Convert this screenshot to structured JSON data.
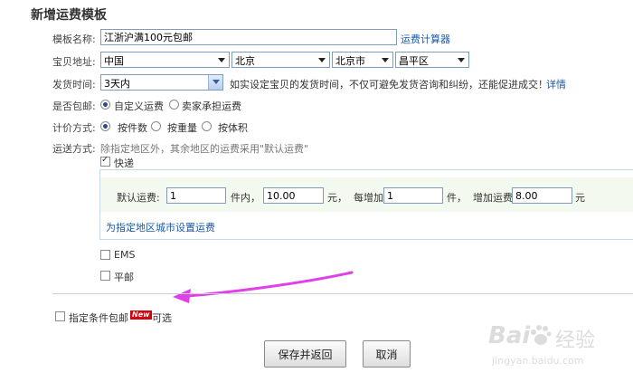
{
  "page_title": "新增运费模板",
  "template_name": {
    "label": "模板名称:",
    "value": "江浙沪满100元包邮",
    "calculator_link": "运费计算器"
  },
  "address": {
    "label": "宝贝地址:",
    "country": "中国",
    "province": "北京",
    "city": "北京市",
    "district": "昌平区"
  },
  "ship_time": {
    "label": "发货时间:",
    "value": "3天内",
    "hint": "如实设定宝贝的发货时间，不仅可避免发货咨询和纠纷，还能促进成交！",
    "detail_link": "详情"
  },
  "free_shipping": {
    "label": "是否包邮:",
    "option_custom": "自定义运费",
    "option_seller": "卖家承担运费",
    "selected": "自定义运费"
  },
  "pricing": {
    "label": "计价方式:",
    "option_piece": "按件数",
    "option_weight": "按重量",
    "option_volume": "按体积",
    "selected": "按件数"
  },
  "delivery": {
    "label": "运送方式:",
    "hint": "除指定地区外，其余地区的运费采用\"默认运费\"",
    "express": {
      "label": "快递",
      "checked": true,
      "default_fee_label": "默认运费:",
      "first_qty": "1",
      "within_label": "件内，",
      "first_fee": "10.00",
      "yuan_each_label": "元，  每增加",
      "add_qty": "1",
      "piece_add_label": "件，  增加运费",
      "add_fee": "8.00",
      "yuan_label": "元",
      "region_link": "为指定地区城市设置运费"
    },
    "ems": {
      "label": "EMS",
      "checked": false
    },
    "surface": {
      "label": "平邮",
      "checked": false
    }
  },
  "conditional_free": {
    "label": "指定条件包邮",
    "badge": "New",
    "optional": "可选",
    "checked": false
  },
  "buttons": {
    "save": "保存并返回",
    "cancel": "取消"
  },
  "watermark": {
    "brand": "Bai",
    "brand_tail": "经验",
    "url": "jingyan.baidu.com"
  },
  "colors": {
    "link": "#1b5aa6",
    "arrow": "#e040e8",
    "badge": "#d4000f"
  }
}
